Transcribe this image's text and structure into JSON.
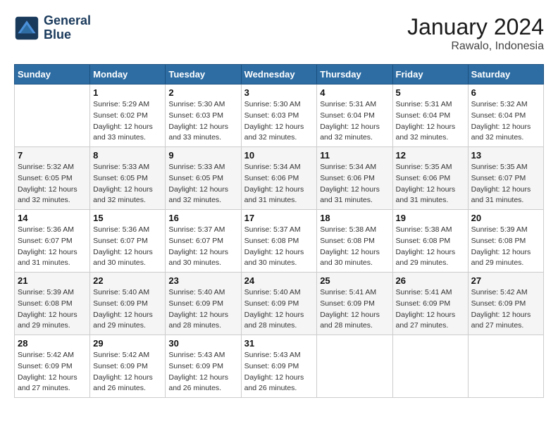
{
  "header": {
    "logo_line1": "General",
    "logo_line2": "Blue",
    "month_year": "January 2024",
    "location": "Rawalo, Indonesia"
  },
  "weekdays": [
    "Sunday",
    "Monday",
    "Tuesday",
    "Wednesday",
    "Thursday",
    "Friday",
    "Saturday"
  ],
  "weeks": [
    [
      {
        "day": "",
        "sunrise": "",
        "sunset": "",
        "daylight": ""
      },
      {
        "day": "1",
        "sunrise": "Sunrise: 5:29 AM",
        "sunset": "Sunset: 6:02 PM",
        "daylight": "Daylight: 12 hours and 33 minutes."
      },
      {
        "day": "2",
        "sunrise": "Sunrise: 5:30 AM",
        "sunset": "Sunset: 6:03 PM",
        "daylight": "Daylight: 12 hours and 33 minutes."
      },
      {
        "day": "3",
        "sunrise": "Sunrise: 5:30 AM",
        "sunset": "Sunset: 6:03 PM",
        "daylight": "Daylight: 12 hours and 32 minutes."
      },
      {
        "day": "4",
        "sunrise": "Sunrise: 5:31 AM",
        "sunset": "Sunset: 6:04 PM",
        "daylight": "Daylight: 12 hours and 32 minutes."
      },
      {
        "day": "5",
        "sunrise": "Sunrise: 5:31 AM",
        "sunset": "Sunset: 6:04 PM",
        "daylight": "Daylight: 12 hours and 32 minutes."
      },
      {
        "day": "6",
        "sunrise": "Sunrise: 5:32 AM",
        "sunset": "Sunset: 6:04 PM",
        "daylight": "Daylight: 12 hours and 32 minutes."
      }
    ],
    [
      {
        "day": "7",
        "sunrise": "Sunrise: 5:32 AM",
        "sunset": "Sunset: 6:05 PM",
        "daylight": "Daylight: 12 hours and 32 minutes."
      },
      {
        "day": "8",
        "sunrise": "Sunrise: 5:33 AM",
        "sunset": "Sunset: 6:05 PM",
        "daylight": "Daylight: 12 hours and 32 minutes."
      },
      {
        "day": "9",
        "sunrise": "Sunrise: 5:33 AM",
        "sunset": "Sunset: 6:05 PM",
        "daylight": "Daylight: 12 hours and 32 minutes."
      },
      {
        "day": "10",
        "sunrise": "Sunrise: 5:34 AM",
        "sunset": "Sunset: 6:06 PM",
        "daylight": "Daylight: 12 hours and 31 minutes."
      },
      {
        "day": "11",
        "sunrise": "Sunrise: 5:34 AM",
        "sunset": "Sunset: 6:06 PM",
        "daylight": "Daylight: 12 hours and 31 minutes."
      },
      {
        "day": "12",
        "sunrise": "Sunrise: 5:35 AM",
        "sunset": "Sunset: 6:06 PM",
        "daylight": "Daylight: 12 hours and 31 minutes."
      },
      {
        "day": "13",
        "sunrise": "Sunrise: 5:35 AM",
        "sunset": "Sunset: 6:07 PM",
        "daylight": "Daylight: 12 hours and 31 minutes."
      }
    ],
    [
      {
        "day": "14",
        "sunrise": "Sunrise: 5:36 AM",
        "sunset": "Sunset: 6:07 PM",
        "daylight": "Daylight: 12 hours and 31 minutes."
      },
      {
        "day": "15",
        "sunrise": "Sunrise: 5:36 AM",
        "sunset": "Sunset: 6:07 PM",
        "daylight": "Daylight: 12 hours and 30 minutes."
      },
      {
        "day": "16",
        "sunrise": "Sunrise: 5:37 AM",
        "sunset": "Sunset: 6:07 PM",
        "daylight": "Daylight: 12 hours and 30 minutes."
      },
      {
        "day": "17",
        "sunrise": "Sunrise: 5:37 AM",
        "sunset": "Sunset: 6:08 PM",
        "daylight": "Daylight: 12 hours and 30 minutes."
      },
      {
        "day": "18",
        "sunrise": "Sunrise: 5:38 AM",
        "sunset": "Sunset: 6:08 PM",
        "daylight": "Daylight: 12 hours and 30 minutes."
      },
      {
        "day": "19",
        "sunrise": "Sunrise: 5:38 AM",
        "sunset": "Sunset: 6:08 PM",
        "daylight": "Daylight: 12 hours and 29 minutes."
      },
      {
        "day": "20",
        "sunrise": "Sunrise: 5:39 AM",
        "sunset": "Sunset: 6:08 PM",
        "daylight": "Daylight: 12 hours and 29 minutes."
      }
    ],
    [
      {
        "day": "21",
        "sunrise": "Sunrise: 5:39 AM",
        "sunset": "Sunset: 6:08 PM",
        "daylight": "Daylight: 12 hours and 29 minutes."
      },
      {
        "day": "22",
        "sunrise": "Sunrise: 5:40 AM",
        "sunset": "Sunset: 6:09 PM",
        "daylight": "Daylight: 12 hours and 29 minutes."
      },
      {
        "day": "23",
        "sunrise": "Sunrise: 5:40 AM",
        "sunset": "Sunset: 6:09 PM",
        "daylight": "Daylight: 12 hours and 28 minutes."
      },
      {
        "day": "24",
        "sunrise": "Sunrise: 5:40 AM",
        "sunset": "Sunset: 6:09 PM",
        "daylight": "Daylight: 12 hours and 28 minutes."
      },
      {
        "day": "25",
        "sunrise": "Sunrise: 5:41 AM",
        "sunset": "Sunset: 6:09 PM",
        "daylight": "Daylight: 12 hours and 28 minutes."
      },
      {
        "day": "26",
        "sunrise": "Sunrise: 5:41 AM",
        "sunset": "Sunset: 6:09 PM",
        "daylight": "Daylight: 12 hours and 27 minutes."
      },
      {
        "day": "27",
        "sunrise": "Sunrise: 5:42 AM",
        "sunset": "Sunset: 6:09 PM",
        "daylight": "Daylight: 12 hours and 27 minutes."
      }
    ],
    [
      {
        "day": "28",
        "sunrise": "Sunrise: 5:42 AM",
        "sunset": "Sunset: 6:09 PM",
        "daylight": "Daylight: 12 hours and 27 minutes."
      },
      {
        "day": "29",
        "sunrise": "Sunrise: 5:42 AM",
        "sunset": "Sunset: 6:09 PM",
        "daylight": "Daylight: 12 hours and 26 minutes."
      },
      {
        "day": "30",
        "sunrise": "Sunrise: 5:43 AM",
        "sunset": "Sunset: 6:09 PM",
        "daylight": "Daylight: 12 hours and 26 minutes."
      },
      {
        "day": "31",
        "sunrise": "Sunrise: 5:43 AM",
        "sunset": "Sunset: 6:09 PM",
        "daylight": "Daylight: 12 hours and 26 minutes."
      },
      {
        "day": "",
        "sunrise": "",
        "sunset": "",
        "daylight": ""
      },
      {
        "day": "",
        "sunrise": "",
        "sunset": "",
        "daylight": ""
      },
      {
        "day": "",
        "sunrise": "",
        "sunset": "",
        "daylight": ""
      }
    ]
  ]
}
